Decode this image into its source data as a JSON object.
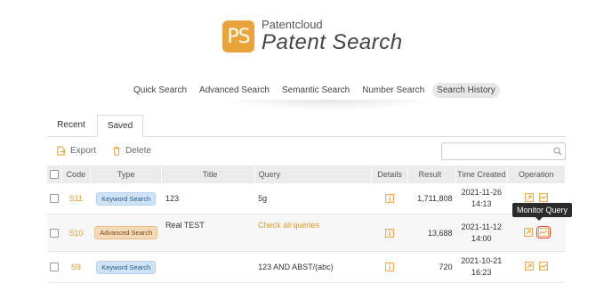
{
  "brand": {
    "logo_letters": "PS",
    "company": "Patentcloud",
    "product": "Patent Search",
    "accent_color": "#e8a33b"
  },
  "search_nav": {
    "items": [
      {
        "label": "Quick Search",
        "active": false
      },
      {
        "label": "Advanced Search",
        "active": false
      },
      {
        "label": "Semantic Search",
        "active": false
      },
      {
        "label": "Number Search",
        "active": false
      },
      {
        "label": "Search History",
        "active": true
      }
    ]
  },
  "tabs": [
    {
      "label": "Recent",
      "active": false
    },
    {
      "label": "Saved",
      "active": true
    }
  ],
  "toolbar": {
    "export_label": "Export",
    "delete_label": "Delete",
    "search_placeholder": ""
  },
  "table": {
    "headers": {
      "code": "Code",
      "type": "Type",
      "title": "Title",
      "query": "Query",
      "details": "Details",
      "result": "Result",
      "time_created": "Time Created",
      "operation": "Operation"
    },
    "rows": [
      {
        "code": "S11",
        "type": "Keyword Search",
        "title": "123",
        "query": "5g",
        "result": "1,711,808",
        "date": "2021-11-26",
        "time": "14:13"
      },
      {
        "code": "S10",
        "type": "Advanced Search",
        "title": "Real TEST",
        "query": "Check all queries",
        "result": "13,688",
        "date": "2021-11-12",
        "time": "14:00"
      },
      {
        "code": "S9",
        "type": "Keyword Search",
        "title": "",
        "query": "123 AND ABST/(abc)",
        "result": "720",
        "date": "2021-10-21",
        "time": "16:23"
      }
    ]
  },
  "tooltip": {
    "text": "Monitor Query"
  },
  "icons": {
    "export": "export-icon",
    "delete": "trash-icon",
    "search": "search-icon",
    "details": "info-icon",
    "open": "open-external-icon",
    "monitor": "monitor-chart-icon"
  }
}
